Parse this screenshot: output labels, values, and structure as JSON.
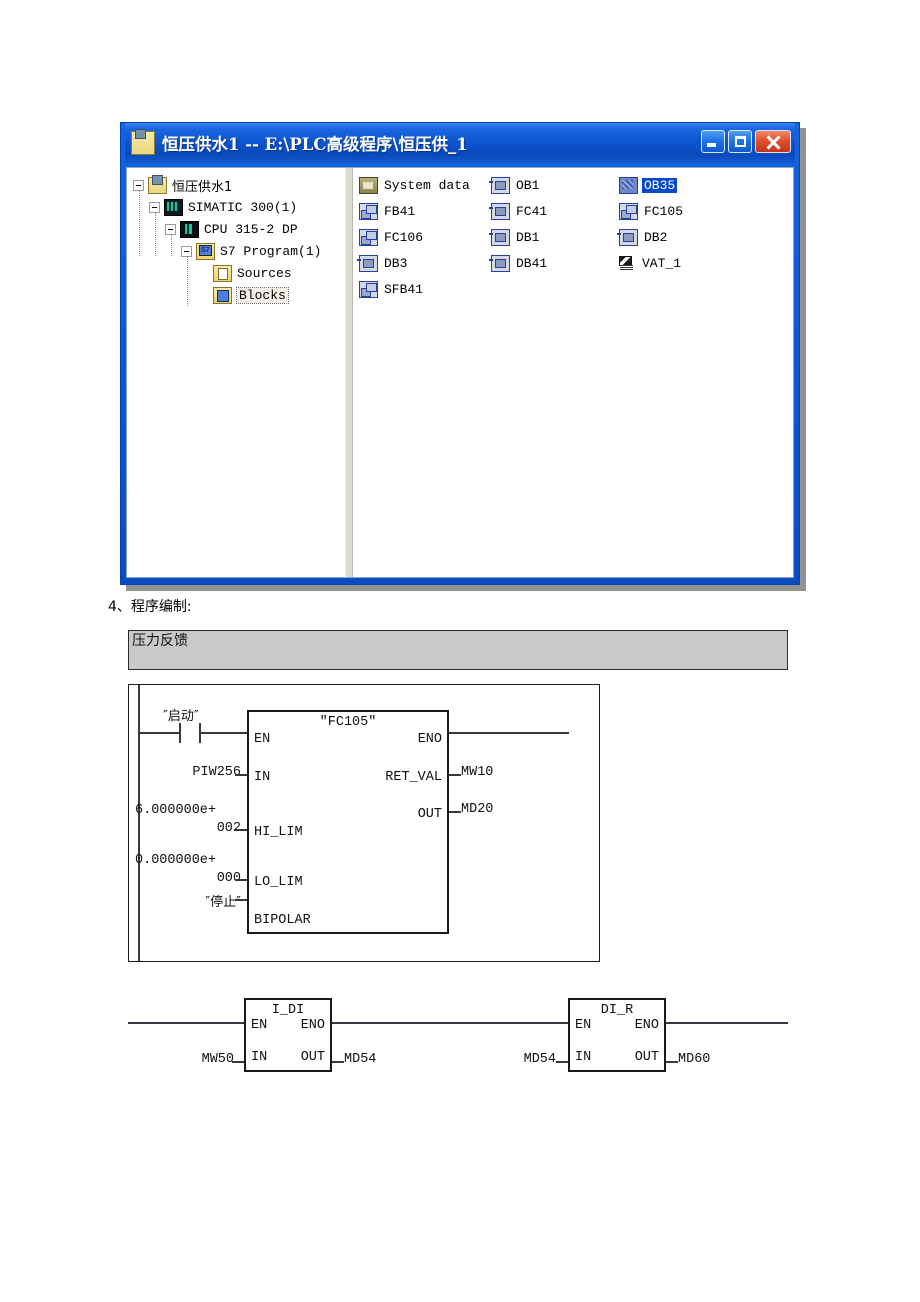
{
  "window": {
    "title": "恒压供水1 -- E:\\PLC高级程序\\恒压供_1",
    "title_icon": "simatic-project-icon",
    "buttons": {
      "minimize": "minimize-button",
      "maximize": "maximize-button",
      "close": "close-button"
    }
  },
  "tree": {
    "items": [
      {
        "label": "恒压供水1",
        "icon": "project-icon",
        "indent": 0,
        "expander": true,
        "cjk": true
      },
      {
        "label": "SIMATIC 300(1)",
        "icon": "station-icon",
        "indent": 1,
        "expander": true,
        "cjk": false
      },
      {
        "label": "CPU 315-2 DP",
        "icon": "cpu-icon",
        "indent": 2,
        "expander": true,
        "cjk": false
      },
      {
        "label": "S7 Program(1)",
        "icon": "s7-program-icon",
        "indent": 3,
        "expander": true,
        "cjk": false
      },
      {
        "label": "Sources",
        "icon": "sources-folder-icon",
        "indent": 4,
        "expander": false,
        "cjk": false
      },
      {
        "label": "Blocks",
        "icon": "blocks-folder-icon",
        "indent": 4,
        "expander": false,
        "cjk": false,
        "selected": true
      }
    ]
  },
  "blocks": {
    "items": [
      {
        "label": "System data",
        "icon": "system-data-icon",
        "selected": false
      },
      {
        "label": "OB1",
        "icon": "ob-icon",
        "selected": false
      },
      {
        "label": "OB35",
        "icon": "ob35-icon",
        "selected": true
      },
      {
        "label": "FB41",
        "icon": "fb-icon",
        "selected": false
      },
      {
        "label": "FC41",
        "icon": "ob-icon",
        "selected": false
      },
      {
        "label": "FC105",
        "icon": "fb-icon",
        "selected": false
      },
      {
        "label": "FC106",
        "icon": "fb-icon",
        "selected": false
      },
      {
        "label": "DB1",
        "icon": "ob-icon",
        "selected": false
      },
      {
        "label": "DB2",
        "icon": "ob-icon",
        "selected": false
      },
      {
        "label": "DB3",
        "icon": "ob-icon",
        "selected": false
      },
      {
        "label": "DB41",
        "icon": "ob-icon",
        "selected": false
      },
      {
        "label": "VAT_1",
        "icon": "var-table-icon",
        "selected": false
      },
      {
        "label": "SFB41",
        "icon": "fb-icon",
        "selected": false
      }
    ]
  },
  "document": {
    "heading": "4、程序编制:",
    "network_title": "压力反馈"
  },
  "ladder": {
    "network1": {
      "contact_label": "″启动″",
      "block": {
        "title": "″FC105″",
        "inputs": [
          {
            "pin": "EN",
            "operand": ""
          },
          {
            "pin": "IN",
            "operand": "PIW256"
          },
          {
            "pin": "HI_LIM",
            "operand": "6.000000e+\n002"
          },
          {
            "pin": "LO_LIM",
            "operand": "0.000000e+\n000"
          },
          {
            "pin": "BIPOLAR",
            "operand": "″停止″"
          }
        ],
        "outputs": [
          {
            "pin": "ENO",
            "operand": ""
          },
          {
            "pin": "RET_VAL",
            "operand": "MW10"
          },
          {
            "pin": "OUT",
            "operand": "MD20"
          }
        ]
      },
      "operand_hi_lim_line1": "6.000000e+",
      "operand_hi_lim_line2": "002",
      "operand_lo_lim_line1": "0.000000e+",
      "operand_lo_lim_line2": "000",
      "operand_in": "PIW256",
      "operand_bipolar": "″停止″",
      "operand_ret_val": "MW10",
      "operand_out": "MD20",
      "pin_en": "EN",
      "pin_eno": "ENO",
      "pin_in": "IN",
      "pin_hi_lim": "HI_LIM",
      "pin_lo_lim": "LO_LIM",
      "pin_bipolar": "BIPOLAR",
      "pin_ret_val": "RET_VAL",
      "pin_out": "OUT"
    },
    "network2": {
      "block_a": {
        "title": "I_DI",
        "pin_en": "EN",
        "pin_eno": "ENO",
        "pin_in": "IN",
        "pin_out": "OUT",
        "operand_in": "MW50",
        "operand_out": "MD54"
      },
      "block_b": {
        "title": "DI_R",
        "pin_en": "EN",
        "pin_eno": "ENO",
        "pin_in": "IN",
        "pin_out": "OUT",
        "operand_in": "MD54",
        "operand_out": "MD60"
      }
    }
  },
  "colors": {
    "title_bar_blue": "#0b57d4",
    "selection_blue": "#0a49c8",
    "network_bar_gray": "#c9c9c9",
    "close_red": "#e0512a"
  }
}
